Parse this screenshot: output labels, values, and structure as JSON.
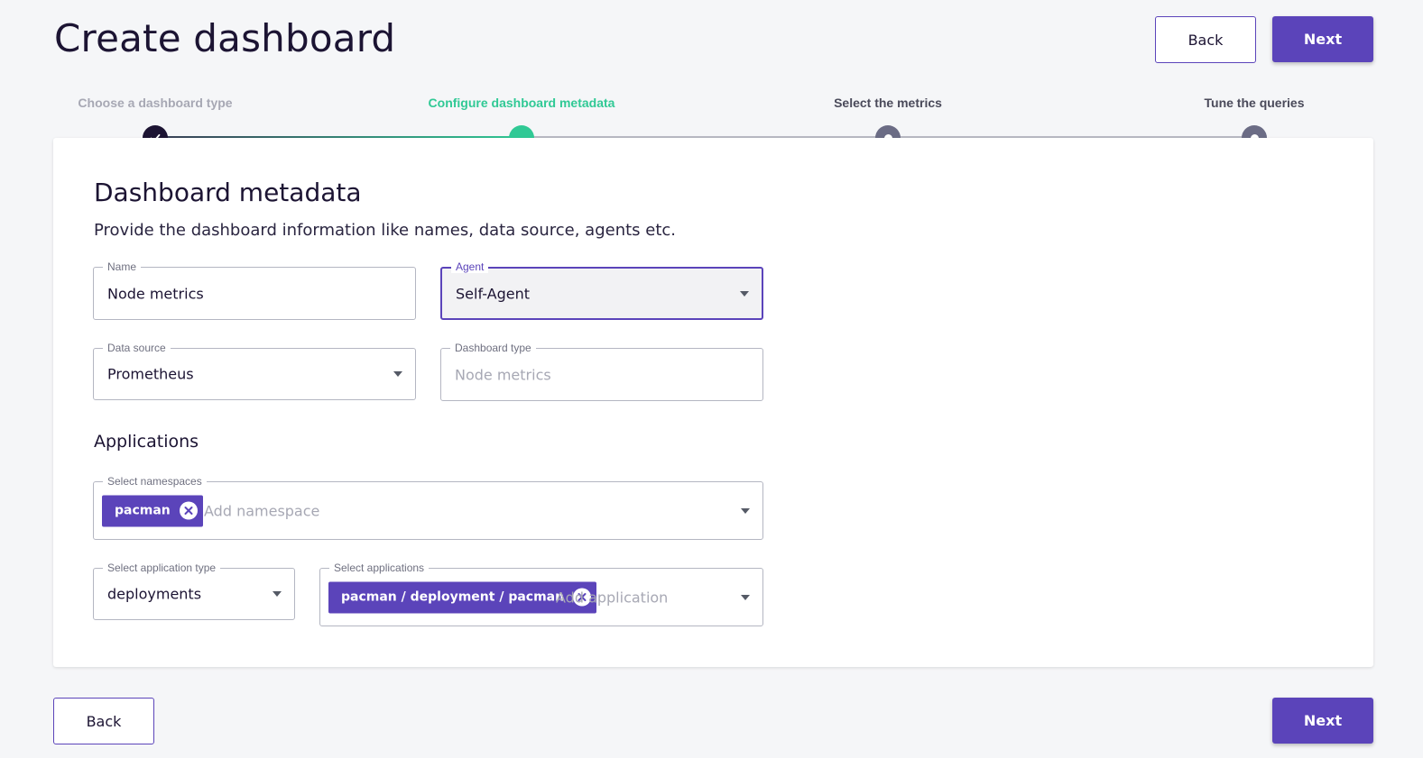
{
  "header": {
    "title": "Create dashboard",
    "back_label": "Back",
    "next_label": "Next"
  },
  "stepper": {
    "steps": [
      {
        "label": "Choose a dashboard type",
        "state": "done"
      },
      {
        "label": "Configure dashboard metadata",
        "state": "active"
      },
      {
        "label": "Select the metrics",
        "state": "todo"
      },
      {
        "label": "Tune the queries",
        "state": "todo"
      }
    ]
  },
  "form": {
    "title": "Dashboard metadata",
    "description": "Provide the dashboard information like names, data source, agents etc.",
    "name": {
      "label": "Name",
      "value": "Node metrics"
    },
    "agent": {
      "label": "Agent",
      "value": "Self-Agent"
    },
    "data_source": {
      "label": "Data source",
      "value": "Prometheus"
    },
    "dashboard_type": {
      "label": "Dashboard type",
      "value": "Node metrics"
    },
    "applications_title": "Applications",
    "namespaces": {
      "label": "Select namespaces",
      "chips": [
        "pacman"
      ],
      "placeholder": "Add namespace"
    },
    "application_type": {
      "label": "Select application type",
      "value": "deployments"
    },
    "applications": {
      "label": "Select applications",
      "chips": [
        "pacman / deployment / pacman"
      ],
      "placeholder": "Add application"
    }
  },
  "footer": {
    "back_label": "Back",
    "next_label": "Next"
  },
  "colors": {
    "primary": "#5b44ba",
    "active_step": "#30c995",
    "done_step": "#1c1433",
    "todo_step": "#6b6c85"
  }
}
